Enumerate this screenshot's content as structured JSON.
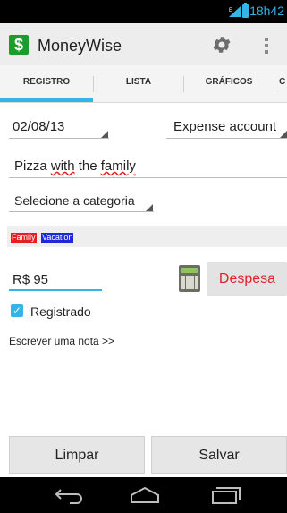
{
  "status_bar": {
    "time": "18h42"
  },
  "app": {
    "title": "MoneyWise",
    "icon_letter": "$"
  },
  "tabs": [
    {
      "label": "REGISTRO"
    },
    {
      "label": "LISTA"
    },
    {
      "label": "GRÁFICOS"
    },
    {
      "label": "C"
    }
  ],
  "form": {
    "date": "02/08/13",
    "account": "Expense account",
    "description_prefix": "Pizza ",
    "description_w1": "with",
    "description_mid": " the ",
    "description_w2": "family",
    "category": "Selecione a categoria",
    "tags": [
      {
        "label": "Family",
        "color": "#e81c24"
      },
      {
        "label": "Vacation",
        "color": "#1e2ad8"
      }
    ],
    "amount": "R$ 95",
    "type_button": "Despesa",
    "registered_label": "Registrado",
    "note_link": "Escrever uma nota >>"
  },
  "buttons": {
    "clear": "Limpar",
    "save": "Salvar"
  }
}
